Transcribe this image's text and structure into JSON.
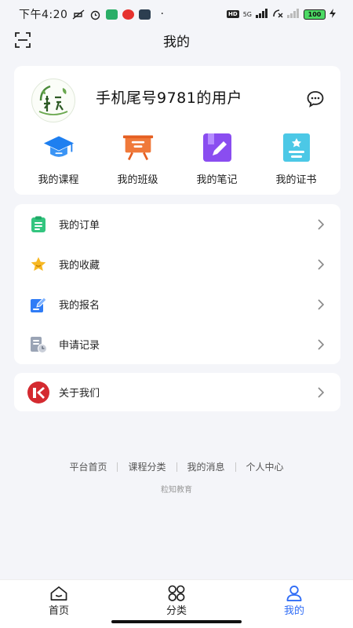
{
  "status_bar": {
    "time": "下午4:20",
    "network": "5G",
    "hd": "HD",
    "battery": "100"
  },
  "header": {
    "title": "我的"
  },
  "profile": {
    "username": "手机尾号9781的用户",
    "avatar_icon": "brand-logo"
  },
  "quick_actions": [
    {
      "label": "我的课程",
      "icon": "graduation-cap-icon",
      "color": "#1e7ff0"
    },
    {
      "label": "我的班级",
      "icon": "class-board-icon",
      "color": "#f0793a"
    },
    {
      "label": "我的笔记",
      "icon": "notes-icon",
      "color": "#8a4df0"
    },
    {
      "label": "我的证书",
      "icon": "certificate-icon",
      "color": "#4cc8e6"
    }
  ],
  "menu": [
    {
      "label": "我的订单",
      "icon": "order-list-icon"
    },
    {
      "label": "我的收藏",
      "icon": "star-icon"
    },
    {
      "label": "我的报名",
      "icon": "edit-form-icon"
    },
    {
      "label": "申请记录",
      "icon": "record-icon"
    }
  ],
  "about": {
    "label": "关于我们",
    "icon": "brand-badge-icon"
  },
  "footer": {
    "links": [
      "平台首页",
      "课程分类",
      "我的消息",
      "个人中心"
    ],
    "brand": "粒知教育"
  },
  "bottom_nav": [
    {
      "label": "首页",
      "icon": "home-icon",
      "active": false
    },
    {
      "label": "分类",
      "icon": "category-icon",
      "active": false
    },
    {
      "label": "我的",
      "icon": "user-icon",
      "active": true
    }
  ],
  "colors": {
    "accent": "#2f6cf6",
    "background": "#f4f5f9"
  }
}
